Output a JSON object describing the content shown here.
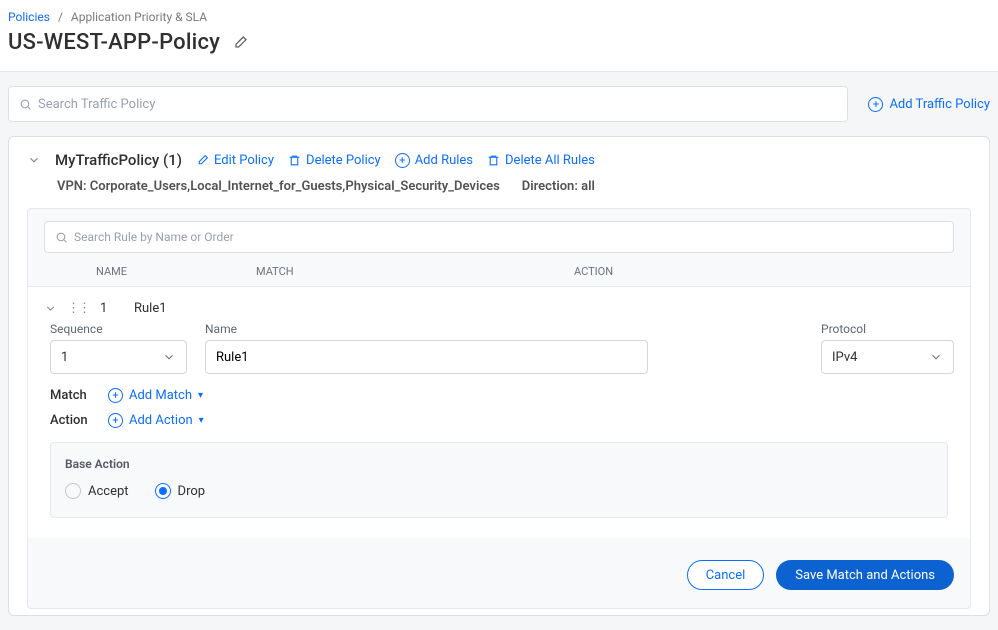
{
  "breadcrumb": {
    "root": "Policies",
    "current": "Application Priority & SLA"
  },
  "page_title": "US-WEST-APP-Policy",
  "search": {
    "placeholder": "Search Traffic Policy"
  },
  "add_policy_label": "Add Traffic Policy",
  "policy": {
    "name": "MyTrafficPolicy",
    "count_display": "(1)",
    "actions": {
      "edit": "Edit Policy",
      "delete": "Delete Policy",
      "add_rules": "Add Rules",
      "delete_all": "Delete All Rules"
    },
    "meta": {
      "vpn_label": "VPN:",
      "vpn_value": "Corporate_Users,Local_Internet_for_Guests,Physical_Security_Devices",
      "direction_label": "Direction:",
      "direction_value": "all"
    }
  },
  "rules": {
    "search_placeholder": "Search Rule by Name or Order",
    "columns": {
      "name": "NAME",
      "match": "MATCH",
      "action": "ACTION"
    },
    "row": {
      "order": "1",
      "name": "Rule1"
    },
    "form": {
      "sequence_label": "Sequence",
      "sequence_value": "1",
      "name_label": "Name",
      "name_value": "Rule1",
      "protocol_label": "Protocol",
      "protocol_value": "IPv4"
    },
    "match": {
      "label": "Match",
      "add": "Add Match"
    },
    "action": {
      "label": "Action",
      "add": "Add Action"
    },
    "base": {
      "title": "Base Action",
      "accept": "Accept",
      "drop": "Drop",
      "selected": "drop"
    },
    "buttons": {
      "cancel": "Cancel",
      "save": "Save Match and Actions"
    }
  }
}
